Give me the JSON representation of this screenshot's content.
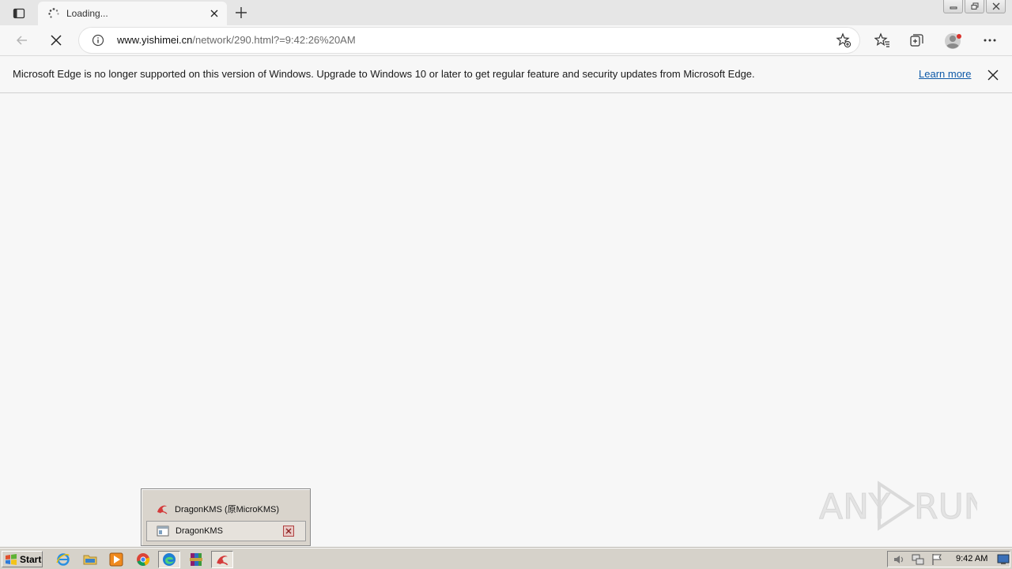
{
  "tab": {
    "title": "Loading..."
  },
  "address": {
    "host": "www.yishimei.cn",
    "path": "/network/290.html?=9:42:26%20AM"
  },
  "infobar": {
    "message": "Microsoft Edge is no longer supported on this version of Windows. Upgrade to Windows 10 or later to get regular feature and security updates from Microsoft Edge.",
    "link": "Learn more"
  },
  "taskbar_popup": {
    "items": [
      {
        "label": "DragonKMS (原MicroKMS)"
      },
      {
        "label": "DragonKMS"
      }
    ]
  },
  "taskbar": {
    "start_label": "Start",
    "apps": [
      "internet-explorer-icon",
      "folder-icon",
      "media-player-icon",
      "chrome-icon",
      "edge-icon",
      "winrar-icon",
      "dragonkms-icon"
    ],
    "clock": "9:42 AM"
  },
  "watermark": {
    "text_left": "ANY",
    "text_right": "RUN"
  },
  "colors": {
    "accent_link": "#0f5aa8",
    "taskbar": "#d6d2ca",
    "page_bg": "#f7f7f7"
  }
}
